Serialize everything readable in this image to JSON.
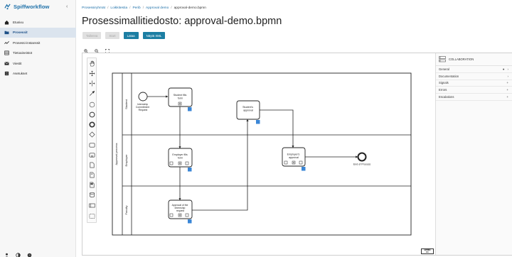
{
  "app": {
    "name": "Spiffworkflow"
  },
  "sidebar": {
    "items": [
      {
        "label": "Etusivu",
        "icon": "home-icon",
        "active": false
      },
      {
        "label": "Prosessit",
        "icon": "folders-icon",
        "active": true
      },
      {
        "label": "Prosessi-instanssit",
        "icon": "activity-icon",
        "active": false
      },
      {
        "label": "Tietoaineistot",
        "icon": "data-stores-icon",
        "active": false
      },
      {
        "label": "Viestit",
        "icon": "mail-icon",
        "active": false
      },
      {
        "label": "Asetukset",
        "icon": "settings-icon",
        "active": false
      }
    ],
    "footer_icons": [
      "user-icon",
      "theme-toggle-icon",
      "help-icon"
    ]
  },
  "breadcrumb": {
    "items": [
      "Prosessiryhmät",
      "Loikkitestia",
      "Perib",
      "Approval demo"
    ],
    "current": "approval-demo.bpmn"
  },
  "page": {
    "title": "Prosessimallitiedosto: approval-demo.bpmn"
  },
  "toolbar": {
    "buttons": [
      {
        "label": "Tallenna",
        "disabled": true
      },
      {
        "label": "Start",
        "disabled": true
      },
      {
        "label": "Lataa",
        "disabled": false
      },
      {
        "label": "Näytä XML",
        "disabled": false
      }
    ]
  },
  "zoom_icons": [
    "zoom-in-icon",
    "zoom-out-icon",
    "fit-to-view-icon"
  ],
  "palette": [
    "hand-tool-icon",
    "lasso-tool-icon",
    "space-tool-icon",
    "global-connect-icon",
    "start-event-icon",
    "intermediate-event-icon",
    "end-event-icon",
    "gateway-icon",
    "task-icon",
    "subprocess-icon",
    "data-object-icon",
    "data-input-icon",
    "data-output-icon",
    "data-store-icon",
    "participant-icon",
    "group-icon"
  ],
  "diagram": {
    "pool_label": "Approval process",
    "lanes": [
      "Student",
      "Employer",
      "Faculty"
    ],
    "nodes": {
      "start_label": [
        "Internship",
        "Commitment",
        "Request"
      ],
      "student_fills": [
        "Student fills",
        "form"
      ],
      "students_approval": [
        "Student's",
        "approval"
      ],
      "employer_fills": [
        "Employer fills",
        "form"
      ],
      "employers_approval": [
        "Employer's",
        "approval"
      ],
      "faculty_approval": [
        "Approval of the",
        "internship",
        "request"
      ],
      "end_label": "End of Process"
    },
    "colors": {
      "stroke": "#222222",
      "accent": "#3a86d6"
    }
  },
  "properties": {
    "header": "COLLABORATION",
    "sections": [
      {
        "label": "General",
        "controls": [
          "●",
          "›"
        ]
      },
      {
        "label": "Documentation",
        "controls": [
          "›"
        ]
      },
      {
        "label": "Signals",
        "controls": [
          "+"
        ]
      },
      {
        "label": "Errors",
        "controls": [
          "+"
        ]
      },
      {
        "label": "Escalations",
        "controls": [
          "+"
        ]
      }
    ]
  },
  "logo": {
    "line1": "BPMN",
    "line2": "IO"
  }
}
